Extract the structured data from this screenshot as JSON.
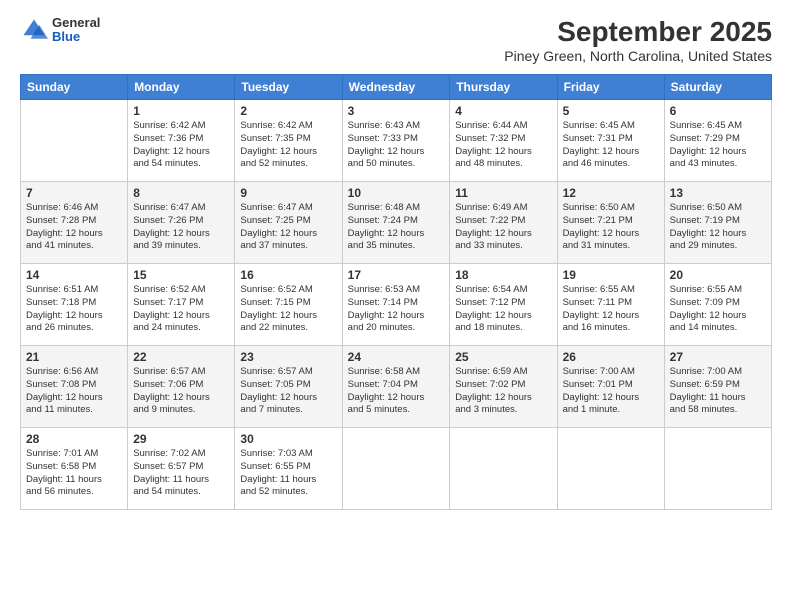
{
  "logo": {
    "general": "General",
    "blue": "Blue"
  },
  "title": "September 2025",
  "subtitle": "Piney Green, North Carolina, United States",
  "days_header": [
    "Sunday",
    "Monday",
    "Tuesday",
    "Wednesday",
    "Thursday",
    "Friday",
    "Saturday"
  ],
  "weeks": [
    [
      {
        "day": "",
        "info": ""
      },
      {
        "day": "1",
        "info": "Sunrise: 6:42 AM\nSunset: 7:36 PM\nDaylight: 12 hours\nand 54 minutes."
      },
      {
        "day": "2",
        "info": "Sunrise: 6:42 AM\nSunset: 7:35 PM\nDaylight: 12 hours\nand 52 minutes."
      },
      {
        "day": "3",
        "info": "Sunrise: 6:43 AM\nSunset: 7:33 PM\nDaylight: 12 hours\nand 50 minutes."
      },
      {
        "day": "4",
        "info": "Sunrise: 6:44 AM\nSunset: 7:32 PM\nDaylight: 12 hours\nand 48 minutes."
      },
      {
        "day": "5",
        "info": "Sunrise: 6:45 AM\nSunset: 7:31 PM\nDaylight: 12 hours\nand 46 minutes."
      },
      {
        "day": "6",
        "info": "Sunrise: 6:45 AM\nSunset: 7:29 PM\nDaylight: 12 hours\nand 43 minutes."
      }
    ],
    [
      {
        "day": "7",
        "info": "Sunrise: 6:46 AM\nSunset: 7:28 PM\nDaylight: 12 hours\nand 41 minutes."
      },
      {
        "day": "8",
        "info": "Sunrise: 6:47 AM\nSunset: 7:26 PM\nDaylight: 12 hours\nand 39 minutes."
      },
      {
        "day": "9",
        "info": "Sunrise: 6:47 AM\nSunset: 7:25 PM\nDaylight: 12 hours\nand 37 minutes."
      },
      {
        "day": "10",
        "info": "Sunrise: 6:48 AM\nSunset: 7:24 PM\nDaylight: 12 hours\nand 35 minutes."
      },
      {
        "day": "11",
        "info": "Sunrise: 6:49 AM\nSunset: 7:22 PM\nDaylight: 12 hours\nand 33 minutes."
      },
      {
        "day": "12",
        "info": "Sunrise: 6:50 AM\nSunset: 7:21 PM\nDaylight: 12 hours\nand 31 minutes."
      },
      {
        "day": "13",
        "info": "Sunrise: 6:50 AM\nSunset: 7:19 PM\nDaylight: 12 hours\nand 29 minutes."
      }
    ],
    [
      {
        "day": "14",
        "info": "Sunrise: 6:51 AM\nSunset: 7:18 PM\nDaylight: 12 hours\nand 26 minutes."
      },
      {
        "day": "15",
        "info": "Sunrise: 6:52 AM\nSunset: 7:17 PM\nDaylight: 12 hours\nand 24 minutes."
      },
      {
        "day": "16",
        "info": "Sunrise: 6:52 AM\nSunset: 7:15 PM\nDaylight: 12 hours\nand 22 minutes."
      },
      {
        "day": "17",
        "info": "Sunrise: 6:53 AM\nSunset: 7:14 PM\nDaylight: 12 hours\nand 20 minutes."
      },
      {
        "day": "18",
        "info": "Sunrise: 6:54 AM\nSunset: 7:12 PM\nDaylight: 12 hours\nand 18 minutes."
      },
      {
        "day": "19",
        "info": "Sunrise: 6:55 AM\nSunset: 7:11 PM\nDaylight: 12 hours\nand 16 minutes."
      },
      {
        "day": "20",
        "info": "Sunrise: 6:55 AM\nSunset: 7:09 PM\nDaylight: 12 hours\nand 14 minutes."
      }
    ],
    [
      {
        "day": "21",
        "info": "Sunrise: 6:56 AM\nSunset: 7:08 PM\nDaylight: 12 hours\nand 11 minutes."
      },
      {
        "day": "22",
        "info": "Sunrise: 6:57 AM\nSunset: 7:06 PM\nDaylight: 12 hours\nand 9 minutes."
      },
      {
        "day": "23",
        "info": "Sunrise: 6:57 AM\nSunset: 7:05 PM\nDaylight: 12 hours\nand 7 minutes."
      },
      {
        "day": "24",
        "info": "Sunrise: 6:58 AM\nSunset: 7:04 PM\nDaylight: 12 hours\nand 5 minutes."
      },
      {
        "day": "25",
        "info": "Sunrise: 6:59 AM\nSunset: 7:02 PM\nDaylight: 12 hours\nand 3 minutes."
      },
      {
        "day": "26",
        "info": "Sunrise: 7:00 AM\nSunset: 7:01 PM\nDaylight: 12 hours\nand 1 minute."
      },
      {
        "day": "27",
        "info": "Sunrise: 7:00 AM\nSunset: 6:59 PM\nDaylight: 11 hours\nand 58 minutes."
      }
    ],
    [
      {
        "day": "28",
        "info": "Sunrise: 7:01 AM\nSunset: 6:58 PM\nDaylight: 11 hours\nand 56 minutes."
      },
      {
        "day": "29",
        "info": "Sunrise: 7:02 AM\nSunset: 6:57 PM\nDaylight: 11 hours\nand 54 minutes."
      },
      {
        "day": "30",
        "info": "Sunrise: 7:03 AM\nSunset: 6:55 PM\nDaylight: 11 hours\nand 52 minutes."
      },
      {
        "day": "",
        "info": ""
      },
      {
        "day": "",
        "info": ""
      },
      {
        "day": "",
        "info": ""
      },
      {
        "day": "",
        "info": ""
      }
    ]
  ]
}
